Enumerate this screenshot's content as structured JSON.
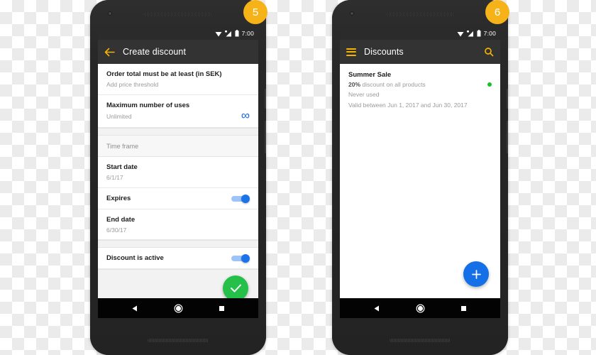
{
  "badges": [
    {
      "name": "step-5",
      "label": "5"
    },
    {
      "name": "step-6",
      "label": "6"
    }
  ],
  "colors": {
    "accent_amber": "#f5b301",
    "badge_amber": "#f6b319",
    "toolbar": "#333333",
    "statusbar": "#2b2b2b",
    "fab_green": "#24c04a",
    "fab_blue": "#1570e8",
    "toggle_blue": "#1a73e8",
    "infinity_blue": "#1565e0",
    "status_dot_green": "#17c127"
  },
  "phone_one": {
    "statusbar": {
      "time": "7:00",
      "wifi_icon": "wifi-icon",
      "signal_icon": "signal-icon",
      "battery_icon": "battery-icon"
    },
    "toolbar": {
      "back_icon": "back-arrow-icon",
      "title": "Create discount"
    },
    "rows": [
      {
        "name": "order-total-threshold",
        "primary": "Order total must be at least (in SEK)",
        "secondary": "Add price threshold"
      },
      {
        "name": "maximum-number-of-uses",
        "primary": "Maximum number of uses",
        "secondary": "Unlimited",
        "control": "infinity",
        "control_glyph": "∞"
      }
    ],
    "section_header": "Time frame",
    "timeframe_rows": [
      {
        "name": "start-date",
        "primary": "Start date",
        "value": "6/1/17"
      },
      {
        "name": "expires",
        "primary": "Expires",
        "control": "switch",
        "switch_on": true
      },
      {
        "name": "end-date",
        "primary": "End date",
        "value": "6/30/17"
      }
    ],
    "active_row": {
      "name": "discount-is-active",
      "primary": "Discount is active",
      "control": "switch",
      "switch_on": true
    },
    "fab": {
      "name": "confirm-fab",
      "icon": "check-icon"
    },
    "navbar": {
      "back": "back-triangle-icon",
      "home": "home-circle-icon",
      "recents": "recents-square-icon"
    }
  },
  "phone_two": {
    "statusbar": {
      "time": "7:00",
      "wifi_icon": "wifi-icon",
      "signal_icon": "signal-icon",
      "battery_icon": "battery-icon"
    },
    "toolbar": {
      "menu_icon": "hamburger-menu-icon",
      "title": "Discounts",
      "search_icon": "search-icon"
    },
    "discount": {
      "name": "summer-sale",
      "title": "Summer Sale",
      "percent": "20%",
      "description": " discount on all products",
      "usage": "Never used",
      "validity": "Valid between Jun 1, 2017 and Jun 30, 2017",
      "status": "active"
    },
    "fab": {
      "name": "add-discount-fab",
      "icon": "plus-icon"
    },
    "navbar": {
      "back": "back-triangle-icon",
      "home": "home-circle-icon",
      "recents": "recents-square-icon"
    }
  }
}
